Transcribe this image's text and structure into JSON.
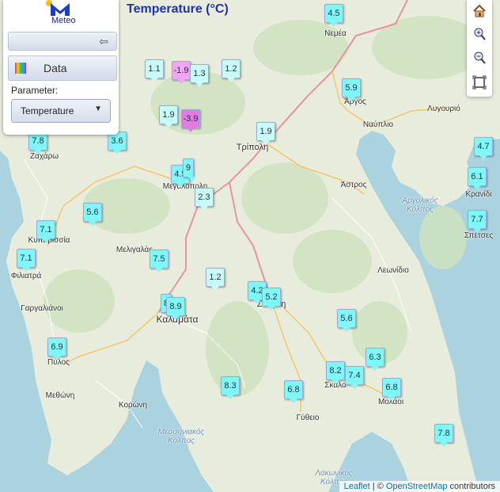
{
  "title": "Temperature (°C)",
  "logo": {
    "text": "Meteo"
  },
  "panel": {
    "data_label": "Data",
    "parameter_label": "Parameter:",
    "parameter_value": "Temperature"
  },
  "toolbar": {
    "home": "home-icon",
    "zoom_in": "zoom-in-icon",
    "zoom_out": "zoom-out-icon",
    "extent": "full-extent-icon"
  },
  "attribution": {
    "leaflet": "Leaflet",
    "separator": " | © ",
    "osm": "OpenStreetMap",
    "suffix": " contributors"
  },
  "places": [
    {
      "name": "Νεμέα"
    },
    {
      "name": "Άργος"
    },
    {
      "name": "Ναύπλιο"
    },
    {
      "name": "Λυγουριό"
    },
    {
      "name": "Τρίπολη"
    },
    {
      "name": "Άστρος"
    },
    {
      "name": "Κρανίδι"
    },
    {
      "name": "Σπέτσες"
    },
    {
      "name": "Ζαχάρω"
    },
    {
      "name": "Μεγαλόπολη"
    },
    {
      "name": "Κυπαρισσία"
    },
    {
      "name": "Μελιγαλάς"
    },
    {
      "name": "Φιλιατρά"
    },
    {
      "name": "Γαργαλιάνοι"
    },
    {
      "name": "Καλαμάτα"
    },
    {
      "name": "Πύλος"
    },
    {
      "name": "Μεθώνη"
    },
    {
      "name": "Κορώνη"
    },
    {
      "name": "Λεωνίδιο"
    },
    {
      "name": "Σπάρτη"
    },
    {
      "name": "Σκάλα"
    },
    {
      "name": "Μολάοι"
    },
    {
      "name": "Γύθειο"
    },
    {
      "name": "Αργολικός Κόλπος"
    },
    {
      "name": "Μεσσηνιακός Κόλπος"
    },
    {
      "name": "Λακωνικός Κόλπος"
    }
  ],
  "stations": [
    {
      "value": "4.5",
      "color": "#7ff7f7"
    },
    {
      "value": "1.1",
      "color": "#c8fbfb"
    },
    {
      "value": "-1.9",
      "color": "#f2a6f2"
    },
    {
      "value": "1.3",
      "color": "#c8fbfb"
    },
    {
      "value": "1.2",
      "color": "#c8fbfb"
    },
    {
      "value": "5.9",
      "color": "#7ff7f7"
    },
    {
      "value": "1.9",
      "color": "#c8fbfb"
    },
    {
      "value": "-3.9",
      "color": "#e27ae2"
    },
    {
      "value": "1.9",
      "color": "#c8fbfb"
    },
    {
      "value": "7.8",
      "color": "#7ff7f7"
    },
    {
      "value": "3.6",
      "color": "#7ff7f7"
    },
    {
      "value": "4.7",
      "color": "#7ff7f7"
    },
    {
      "value": "4.5",
      "color": "#7ff7f7"
    },
    {
      "value": "9",
      "color": "#7ff7f7"
    },
    {
      "value": "6.1",
      "color": "#7ff7f7"
    },
    {
      "value": "2.3",
      "color": "#c8fbfb"
    },
    {
      "value": "5.6",
      "color": "#7ff7f7"
    },
    {
      "value": "7.7",
      "color": "#7ff7f7"
    },
    {
      "value": "7.1",
      "color": "#7ff7f7"
    },
    {
      "value": "7.1",
      "color": "#7ff7f7"
    },
    {
      "value": "7.5",
      "color": "#7ff7f7"
    },
    {
      "value": "1.2",
      "color": "#c8fbfb"
    },
    {
      "value": "4.2",
      "color": "#7ff7f7"
    },
    {
      "value": "5.2",
      "color": "#7ff7f7"
    },
    {
      "value": "8",
      "color": "#7ff7f7"
    },
    {
      "value": "8.9",
      "color": "#7ff7f7"
    },
    {
      "value": "5.6",
      "color": "#7ff7f7"
    },
    {
      "value": "6.9",
      "color": "#7ff7f7"
    },
    {
      "value": "6.3",
      "color": "#7ff7f7"
    },
    {
      "value": "8.2",
      "color": "#7ff7f7"
    },
    {
      "value": "7.4",
      "color": "#7ff7f7"
    },
    {
      "value": "8.3",
      "color": "#7ff7f7"
    },
    {
      "value": "6.8",
      "color": "#7ff7f7"
    },
    {
      "value": "6.8",
      "color": "#7ff7f7"
    },
    {
      "value": "7.8",
      "color": "#7ff7f7"
    }
  ]
}
